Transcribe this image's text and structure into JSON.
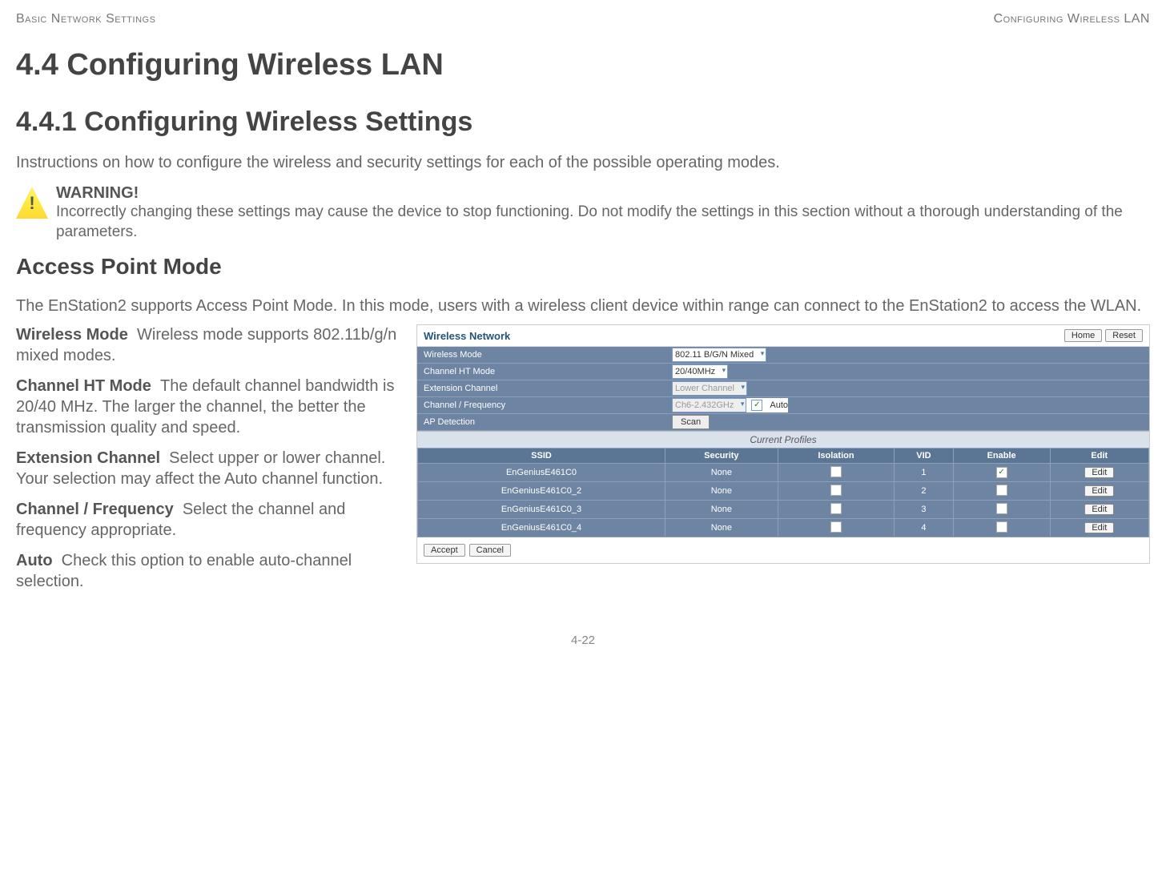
{
  "header": {
    "left": "Basic Network Settings",
    "right": "Configuring Wireless LAN"
  },
  "section_number_title": "4.4 Configuring Wireless LAN",
  "subsection_title": "4.4.1 Configuring Wireless Settings",
  "intro": "Instructions on how to configure the wireless and security settings for each of the possible operating modes.",
  "warning": {
    "label": "WARNING!",
    "body": "Incorrectly changing these settings may cause the device to stop functioning. Do not modify the settings in this section without a thorough understanding of the parameters."
  },
  "mode_title": "Access Point Mode",
  "mode_desc": "The EnStation2 supports Access Point Mode. In this mode, users with a wireless client device within range can connect to the EnStation2 to access the WLAN.",
  "terms": [
    {
      "label": "Wireless Mode",
      "desc": "Wireless mode supports 802.11b/g/n mixed modes."
    },
    {
      "label": "Channel HT Mode",
      "desc": "The default channel bandwidth is 20/40 MHz. The larger the channel, the better the transmission quality and speed."
    },
    {
      "label": "Extension Channel",
      "desc": "Select upper or lower channel. Your selection may affect the Auto channel function."
    },
    {
      "label": "Channel / Frequency",
      "desc": "Select the channel and frequency appropriate."
    },
    {
      "label": "Auto",
      "desc": "Check this option to enable auto-channel selection."
    }
  ],
  "screenshot": {
    "panel_title": "Wireless Network",
    "home_btn": "Home",
    "reset_btn": "Reset",
    "rows": {
      "wireless_mode": {
        "label": "Wireless Mode",
        "value": "802.11 B/G/N Mixed"
      },
      "channel_ht": {
        "label": "Channel HT Mode",
        "value": "20/40MHz"
      },
      "ext_channel": {
        "label": "Extension Channel",
        "value": "Lower Channel"
      },
      "channel_freq": {
        "label": "Channel / Frequency",
        "value": "Ch6-2.432GHz",
        "auto_label": "Auto",
        "auto_checked": "✓"
      },
      "ap_detection": {
        "label": "AP Detection",
        "button": "Scan"
      }
    },
    "profiles_header": "Current Profiles",
    "profiles_columns": [
      "SSID",
      "Security",
      "Isolation",
      "VID",
      "Enable",
      "Edit"
    ],
    "profiles": [
      {
        "ssid": "EnGeniusE461C0",
        "security": "None",
        "isolation": "",
        "vid": "1",
        "enable": "✓",
        "edit": "Edit"
      },
      {
        "ssid": "EnGeniusE461C0_2",
        "security": "None",
        "isolation": "",
        "vid": "2",
        "enable": "",
        "edit": "Edit"
      },
      {
        "ssid": "EnGeniusE461C0_3",
        "security": "None",
        "isolation": "",
        "vid": "3",
        "enable": "",
        "edit": "Edit"
      },
      {
        "ssid": "EnGeniusE461C0_4",
        "security": "None",
        "isolation": "",
        "vid": "4",
        "enable": "",
        "edit": "Edit"
      }
    ],
    "accept_btn": "Accept",
    "cancel_btn": "Cancel"
  },
  "page_number": "4-22"
}
